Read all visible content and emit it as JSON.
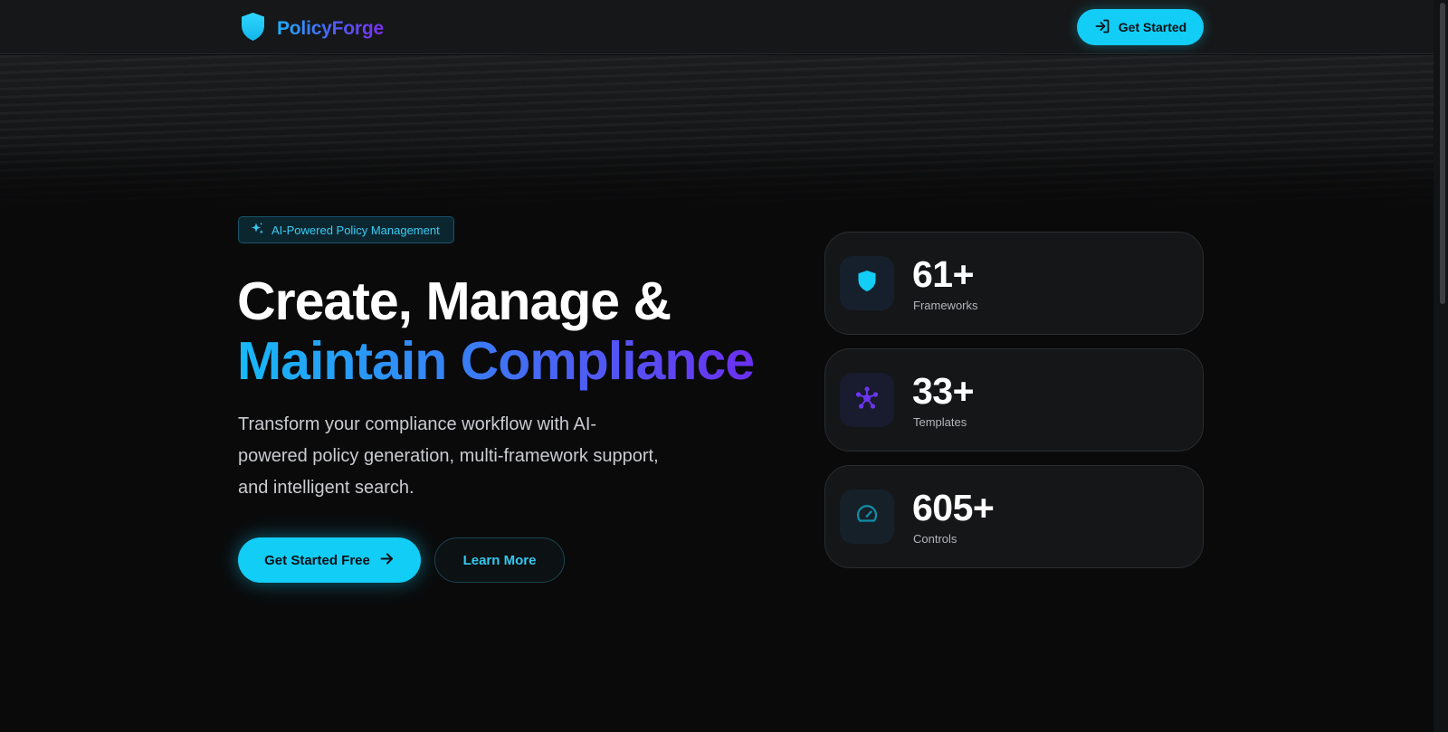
{
  "header": {
    "brand": "PolicyForge",
    "cta_label": "Get Started"
  },
  "hero": {
    "badge": "AI-Powered Policy Management",
    "headline_line1": "Create, Manage &",
    "headline_line2": "Maintain Compliance",
    "subtitle": "Transform your compliance workflow with AI-powered policy generation, multi-framework support, and intelligent search.",
    "primary_cta": "Get Started Free",
    "secondary_cta": "Learn More"
  },
  "stats": [
    {
      "value": "61+",
      "label": "Frameworks",
      "icon": "shield-icon",
      "color": "#12cdf5"
    },
    {
      "value": "33+",
      "label": "Templates",
      "icon": "network-icon",
      "color": "#6a35f0"
    },
    {
      "value": "605+",
      "label": "Controls",
      "icon": "gauge-icon",
      "color": "#0f8fa8"
    }
  ],
  "colors": {
    "accent": "#12cdf5",
    "purple": "#6b2ff0",
    "background": "#0a0a0b"
  }
}
